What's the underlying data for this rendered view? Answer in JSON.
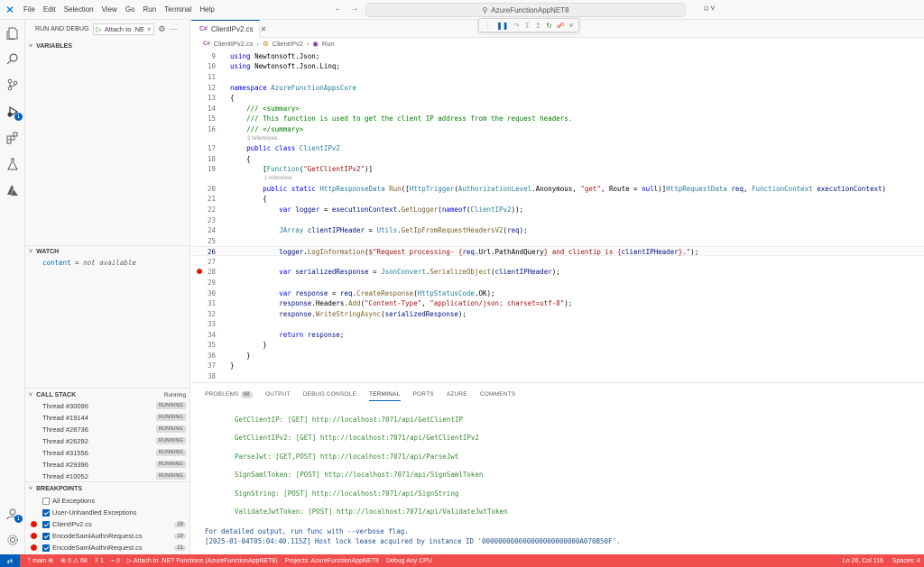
{
  "titlebar": {
    "menu": [
      "File",
      "Edit",
      "Selection",
      "View",
      "Go",
      "Run",
      "Terminal",
      "Help"
    ],
    "search": "AzureFunctionAppNET8"
  },
  "sidebar": {
    "run_label": "RUN AND DEBUG",
    "config": "Attach to .NE",
    "variables_title": "VARIABLES",
    "watch_title": "WATCH",
    "watch": {
      "name": "content",
      "eq": " = ",
      "value": "not available"
    },
    "callstack_title": "CALL STACK",
    "callstack_status": "Running",
    "threads": [
      {
        "name": "Thread #30096",
        "state": "RUNNING"
      },
      {
        "name": "Thread #19144",
        "state": "RUNNING"
      },
      {
        "name": "Thread #28736",
        "state": "RUNNING"
      },
      {
        "name": "Thread #26292",
        "state": "RUNNING"
      },
      {
        "name": "Thread #31556",
        "state": "RUNNING"
      },
      {
        "name": "Thread #29396",
        "state": "RUNNING"
      },
      {
        "name": "Thread #10052",
        "state": "RUNNING"
      }
    ],
    "breakpoints_title": "BREAKPOINTS",
    "breakpoints": [
      {
        "label": "All Exceptions",
        "checked": false,
        "dot": false,
        "count": ""
      },
      {
        "label": "User-Unhandled Exceptions",
        "checked": true,
        "dot": false,
        "count": ""
      },
      {
        "label": "ClientIPv2.cs",
        "checked": true,
        "dot": true,
        "count": "28"
      },
      {
        "label": "EncodeSamlAuthnRequest.cs",
        "checked": true,
        "dot": true,
        "count": "19"
      },
      {
        "label": "EncodeSamlAuthnRequest.cs",
        "checked": true,
        "dot": true,
        "count": "21"
      }
    ]
  },
  "editor": {
    "tab": "ClientIPv2.cs",
    "breadcrumb": [
      "ClientIPv2.cs",
      "ClientIPv2",
      "Run"
    ],
    "codelens": {
      "refs2": "2 references",
      "refs1": "1 reference"
    },
    "line_numbers": [
      "9",
      "10",
      "11",
      "12",
      "13",
      "14",
      "15",
      "16",
      "17",
      "18",
      "19",
      "20",
      "21",
      "22",
      "23",
      "24",
      "25",
      "26",
      "27",
      "28",
      "29",
      "30",
      "31",
      "32",
      "33",
      "34",
      "35",
      "36",
      "37",
      "38"
    ],
    "current_line": "26",
    "breakpoint_line": "28"
  },
  "panel": {
    "tabs": [
      "PROBLEMS",
      "OUTPUT",
      "DEBUG CONSOLE",
      "TERMINAL",
      "PORTS",
      "AZURE",
      "COMMENTS"
    ],
    "problems_count": "68",
    "active_tab": "TERMINAL",
    "endpoints": [
      "GetClientIP: [GET] http://localhost:7071/api/GetClientIP",
      "GetClientIPv2: [GET] http://localhost:7071/api/GetClientIPv2",
      "ParseJwt: [GET,POST] http://localhost:7071/api/ParseJwt",
      "SignSamlToken: [POST] http://localhost:7071/api/SignSamlToken",
      "SignString: [POST] http://localhost:7071/api/SignString",
      "ValidateJwtToken: [POST] http://localhost:7071/api/ValidateJwtToken"
    ],
    "info1": "For detailed output, run func with --verbose flag.",
    "info2": "[2025-01-04T05:04:40.115Z] Host lock lease acquired by instance ID '000000000000000000000000A070B50F'."
  },
  "status": {
    "branch": "main",
    "problems": "⊗ 0 ⚠ 68",
    "tasks": "ᛡ 1",
    "ports": "⌁ 0",
    "debug": "Attach to .NET Functions (AzureFunctionAppNET8)",
    "projects": "Projects: AzureFunctionAppNET8",
    "config": "Debug Any CPU",
    "position": "Ln 26, Col 116",
    "spaces": "Spaces: 4"
  },
  "colors": {
    "accent": "#005fb8",
    "statusbar": "#f14c4c",
    "breakpoint": "#e51400"
  }
}
